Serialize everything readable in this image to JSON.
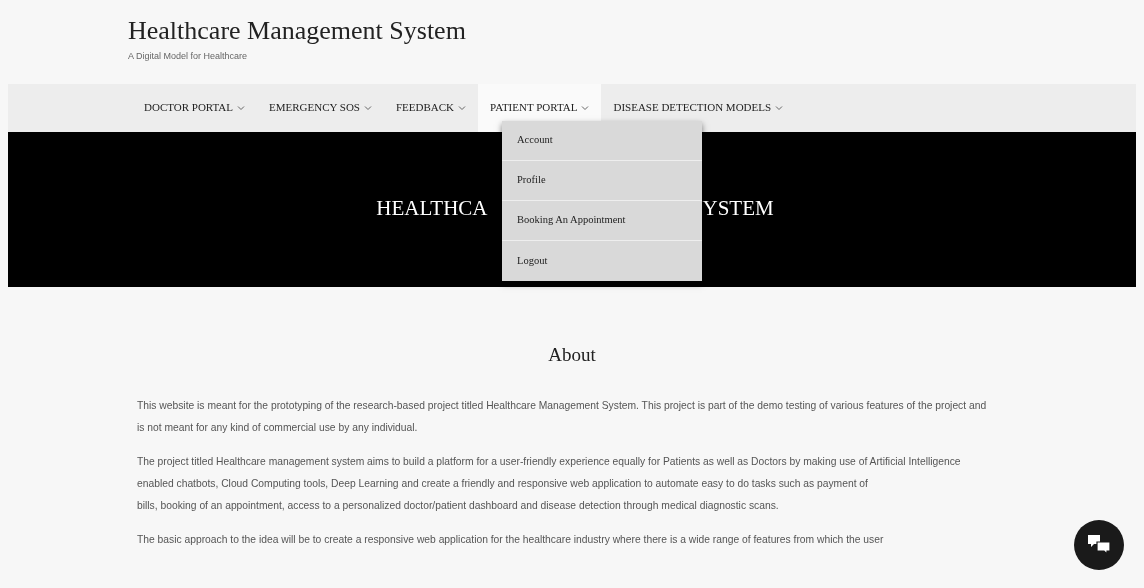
{
  "site": {
    "title": "Healthcare Management System",
    "subtitle": "A Digital Model for Healthcare"
  },
  "nav": [
    {
      "label": "DOCTOR PORTAL",
      "selected": false
    },
    {
      "label": "EMERGENCY SOS",
      "selected": false
    },
    {
      "label": "FEEDBACK",
      "selected": false
    },
    {
      "label": "PATIENT PORTAL",
      "selected": true
    },
    {
      "label": "DISEASE DETECTION MODELS",
      "selected": false
    }
  ],
  "dropdown": {
    "items": [
      "Account",
      "Profile",
      "Booking An Appointment",
      "Logout"
    ]
  },
  "hero": {
    "title_parts": [
      "HEALTHCA",
      "YSTEM"
    ]
  },
  "about": {
    "heading": "About",
    "paragraphs": [
      [
        "This website is meant for the prototyping of the research-based project titled Healthcare Management System. This project is part of the demo testing of various features of the project and is not meant for any kind of commercial use by any individual."
      ],
      [
        "The project titled Healthcare management system aims to build a platform for a user-friendly experience equally for Patients as well as Doctors by making use of Artificial Intelligence enabled chatbots, Cloud Computing tools, Deep Learning and create a friendly and responsive web application to automate easy to do tasks such as payment of",
        "bills, booking of an appointment, access to a personalized doctor/patient dashboard and disease detection through medical diagnostic scans."
      ],
      [
        "The basic approach to the idea will be to create a responsive web application for the healthcare industry where there is a wide range of features from which the user"
      ]
    ]
  }
}
